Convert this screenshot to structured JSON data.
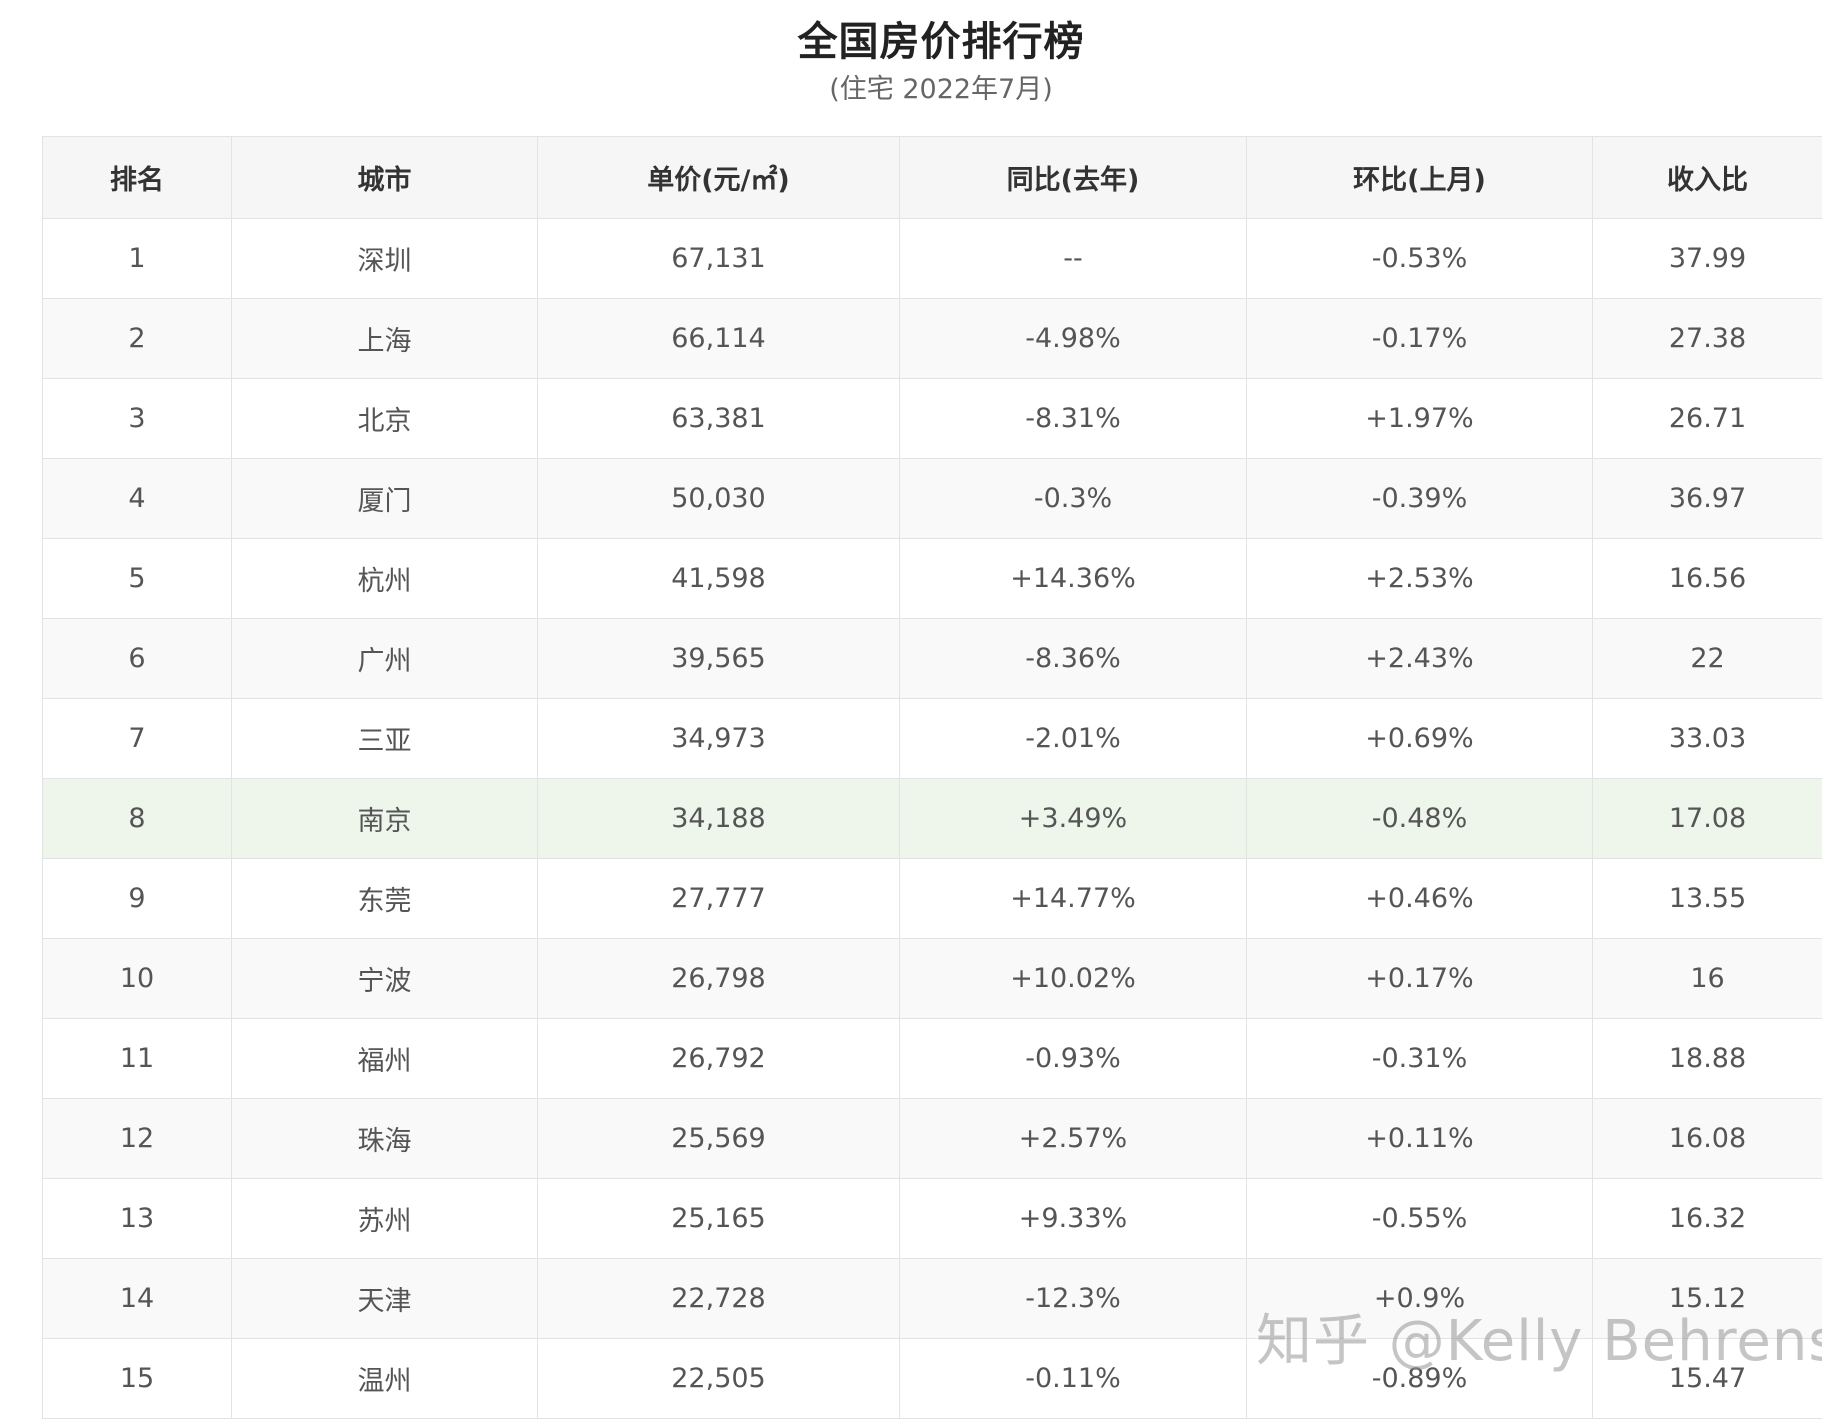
{
  "title": "全国房价排行榜",
  "subtitle": "(住宅 2022年7月)",
  "columns": [
    "排名",
    "城市",
    "单价(元/㎡)",
    "同比(去年)",
    "环比(上月)",
    "收入比"
  ],
  "rows": [
    {
      "rank": "1",
      "city": "深圳",
      "price": "67,131",
      "yoy": "--",
      "mom": "-0.53%",
      "ratio": "37.99"
    },
    {
      "rank": "2",
      "city": "上海",
      "price": "66,114",
      "yoy": "-4.98%",
      "mom": "-0.17%",
      "ratio": "27.38"
    },
    {
      "rank": "3",
      "city": "北京",
      "price": "63,381",
      "yoy": "-8.31%",
      "mom": "+1.97%",
      "ratio": "26.71"
    },
    {
      "rank": "4",
      "city": "厦门",
      "price": "50,030",
      "yoy": "-0.3%",
      "mom": "-0.39%",
      "ratio": "36.97"
    },
    {
      "rank": "5",
      "city": "杭州",
      "price": "41,598",
      "yoy": "+14.36%",
      "mom": "+2.53%",
      "ratio": "16.56"
    },
    {
      "rank": "6",
      "city": "广州",
      "price": "39,565",
      "yoy": "-8.36%",
      "mom": "+2.43%",
      "ratio": "22"
    },
    {
      "rank": "7",
      "city": "三亚",
      "price": "34,973",
      "yoy": "-2.01%",
      "mom": "+0.69%",
      "ratio": "33.03"
    },
    {
      "rank": "8",
      "city": "南京",
      "price": "34,188",
      "yoy": "+3.49%",
      "mom": "-0.48%",
      "ratio": "17.08"
    },
    {
      "rank": "9",
      "city": "东莞",
      "price": "27,777",
      "yoy": "+14.77%",
      "mom": "+0.46%",
      "ratio": "13.55"
    },
    {
      "rank": "10",
      "city": "宁波",
      "price": "26,798",
      "yoy": "+10.02%",
      "mom": "+0.17%",
      "ratio": "16"
    },
    {
      "rank": "11",
      "city": "福州",
      "price": "26,792",
      "yoy": "-0.93%",
      "mom": "-0.31%",
      "ratio": "18.88"
    },
    {
      "rank": "12",
      "city": "珠海",
      "price": "25,569",
      "yoy": "+2.57%",
      "mom": "+0.11%",
      "ratio": "16.08"
    },
    {
      "rank": "13",
      "city": "苏州",
      "price": "25,165",
      "yoy": "+9.33%",
      "mom": "-0.55%",
      "ratio": "16.32"
    },
    {
      "rank": "14",
      "city": "天津",
      "price": "22,728",
      "yoy": "-12.3%",
      "mom": "+0.9%",
      "ratio": "15.12"
    },
    {
      "rank": "15",
      "city": "温州",
      "price": "22,505",
      "yoy": "-0.11%",
      "mom": "-0.89%",
      "ratio": "15.47"
    }
  ],
  "highlighted_row": "8",
  "colors": {
    "up": "#e04848",
    "down": "#4a9c1e",
    "city_link": "#1a75c7",
    "highlight_bg": "#eef6ec"
  },
  "watermark": "知乎 @Kelly Behrens"
}
